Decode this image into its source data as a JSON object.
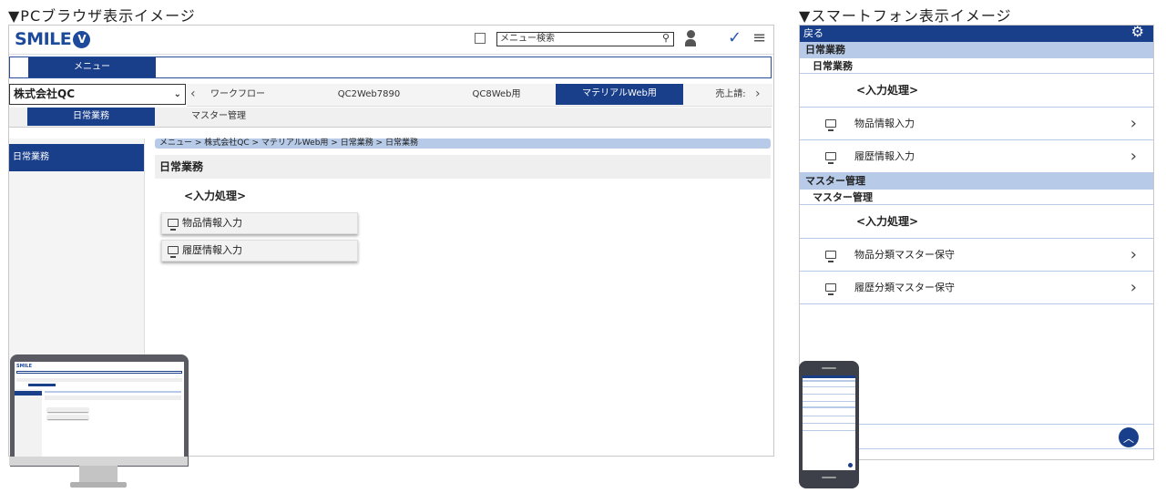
{
  "captions": {
    "pc": "▼PCブラウザ表示イメージ",
    "sp": "▼スマートフォン表示イメージ"
  },
  "logo": {
    "text": "SMILE",
    "mark": "V"
  },
  "pc": {
    "search_placeholder": "メニュー検索",
    "menu_label": "メニュー",
    "company": "株式会社QC",
    "tabs": [
      "ワークフロー",
      "QC2Web7890",
      "QC8Web用",
      "マテリアルWeb用",
      "売上請:"
    ],
    "subtabs": [
      "日常業務",
      "マスター管理"
    ],
    "sidebar_item": "日常業務",
    "breadcrumb": "メニュー >  株式会社QC  > マテリアルWeb用 > 日常業務 > 日常業務",
    "section_title": "日常業務",
    "group_title": "<入力処理>",
    "buttons": [
      "物品情報入力",
      "履歴情報入力"
    ]
  },
  "sp": {
    "back": "戻る",
    "sections": [
      {
        "title": "日常業務",
        "sub": "日常業務",
        "head": "<入力処理>",
        "items": [
          "物品情報入力",
          "履歴情報入力"
        ]
      },
      {
        "title": "マスター管理",
        "sub": "マスター管理",
        "head": "<入力処理>",
        "items": [
          "物品分類マスター保守",
          "履歴分類マスター保守"
        ]
      }
    ]
  },
  "colors": {
    "navy": "#1a3f8a",
    "light_blue": "#b7cbe8"
  }
}
